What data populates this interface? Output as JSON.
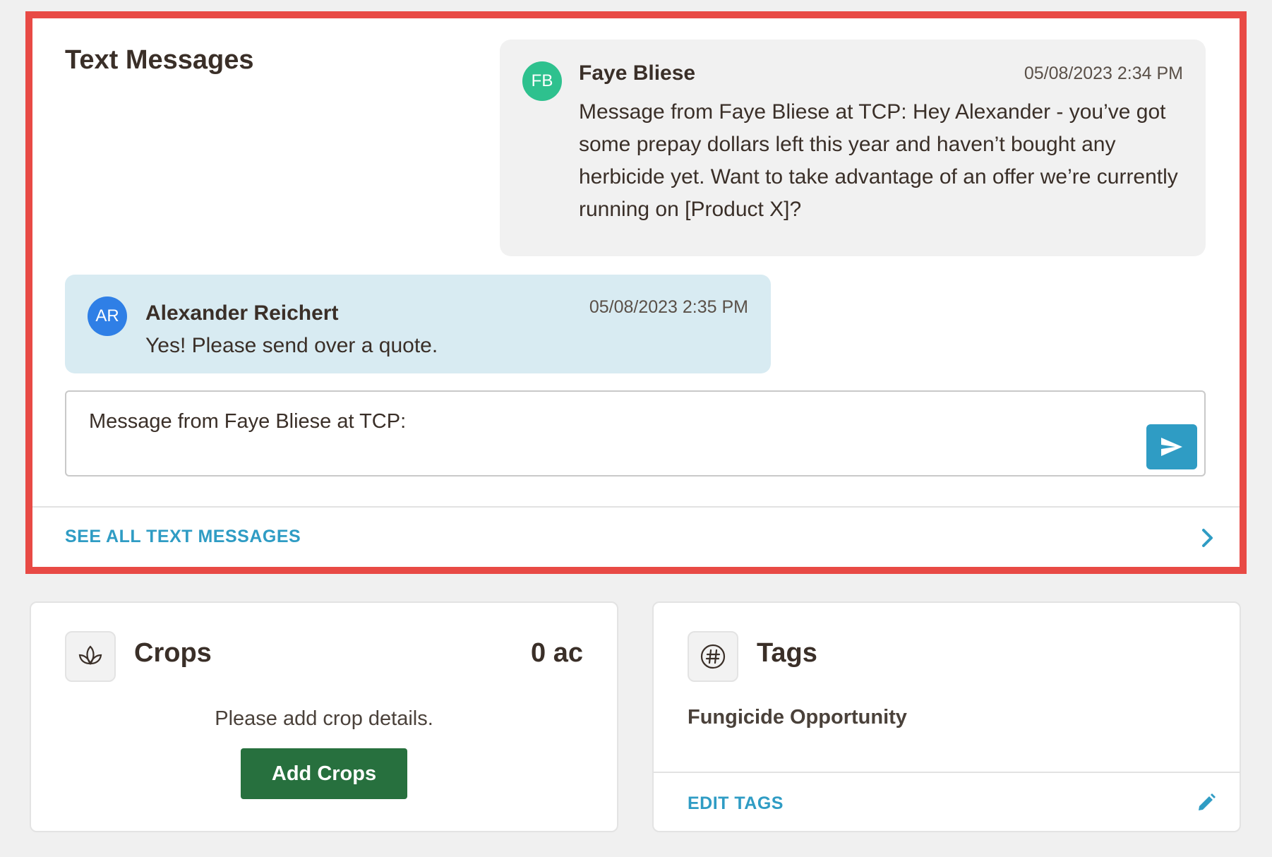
{
  "text_messages": {
    "title": "Text Messages",
    "messages": [
      {
        "initials": "FB",
        "sender": "Faye Bliese",
        "timestamp": "05/08/2023 2:34 PM",
        "body": "Message from Faye Bliese at TCP:  Hey Alexander - you’ve got some prepay dollars left this year and haven’t bought any herbicide yet. Want to take advantage of an offer we’re currently running on [Product X]?",
        "avatar_color": "#2ec18e",
        "bubble_color": "#f1f1f1"
      },
      {
        "initials": "AR",
        "sender": "Alexander Reichert",
        "timestamp": "05/08/2023 2:35 PM",
        "body": "Yes! Please send over a quote.",
        "avatar_color": "#2f7fe6",
        "bubble_color": "#d8ebf2"
      }
    ],
    "composer_value": "Message from Faye Bliese at TCP:",
    "send_icon": "send-icon",
    "see_all_label": "SEE ALL TEXT MESSAGES",
    "highlight_color": "#e84a45"
  },
  "crops": {
    "title": "Crops",
    "total": "0 ac",
    "empty_message": "Please add crop details.",
    "add_button": "Add Crops",
    "icon": "sprout-icon",
    "button_color": "#27703e"
  },
  "tags": {
    "title": "Tags",
    "items": [
      "Fungicide Opportunity"
    ],
    "edit_label": "EDIT TAGS",
    "icon": "hashtag-icon",
    "edit_icon": "pencil-icon"
  },
  "accent_color": "#2f9cc4"
}
